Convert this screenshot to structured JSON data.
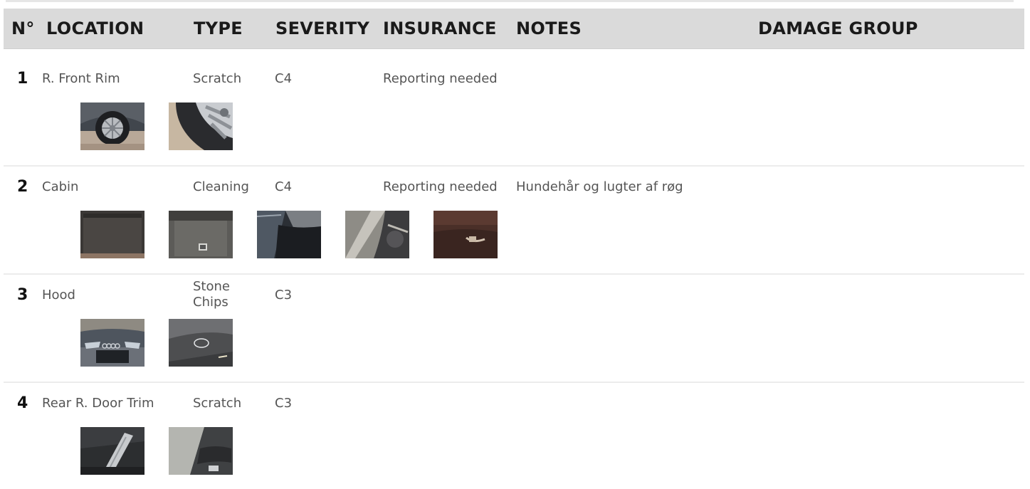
{
  "header": {
    "num": "N°",
    "location": "LOCATION",
    "type": "TYPE",
    "severity": "SEVERITY",
    "insurance": "INSURANCE",
    "notes": "NOTES",
    "damage_group": "DAMAGE GROUP"
  },
  "rows": [
    {
      "num": "1",
      "location": "R. Front Rim",
      "type": "Scratch",
      "severity": "C4",
      "insurance": "Reporting needed",
      "notes": "",
      "damage_group": "",
      "photos": [
        "wheel-photo",
        "rim-closeup-photo"
      ]
    },
    {
      "num": "2",
      "location": "Cabin",
      "type": "Cleaning",
      "severity": "C4",
      "insurance": "Reporting needed",
      "notes": "Hundehår og lugter af røg",
      "damage_group": "",
      "photos": [
        "trunk-carpet-photo",
        "trunk-floor-photo",
        "door-frame-photo",
        "interior-pillar-photo",
        "seat-photo"
      ]
    },
    {
      "num": "3",
      "location": "Hood",
      "type": "Stone Chips",
      "severity": "C3",
      "insurance": "",
      "notes": "",
      "damage_group": "",
      "photos": [
        "car-front-photo",
        "hood-closeup-photo"
      ]
    },
    {
      "num": "4",
      "location": "Rear R. Door Trim",
      "type": "Scratch",
      "severity": "C3",
      "insurance": "",
      "notes": "",
      "damage_group": "",
      "photos": [
        "door-trim-photo",
        "door-interior-photo"
      ]
    }
  ]
}
